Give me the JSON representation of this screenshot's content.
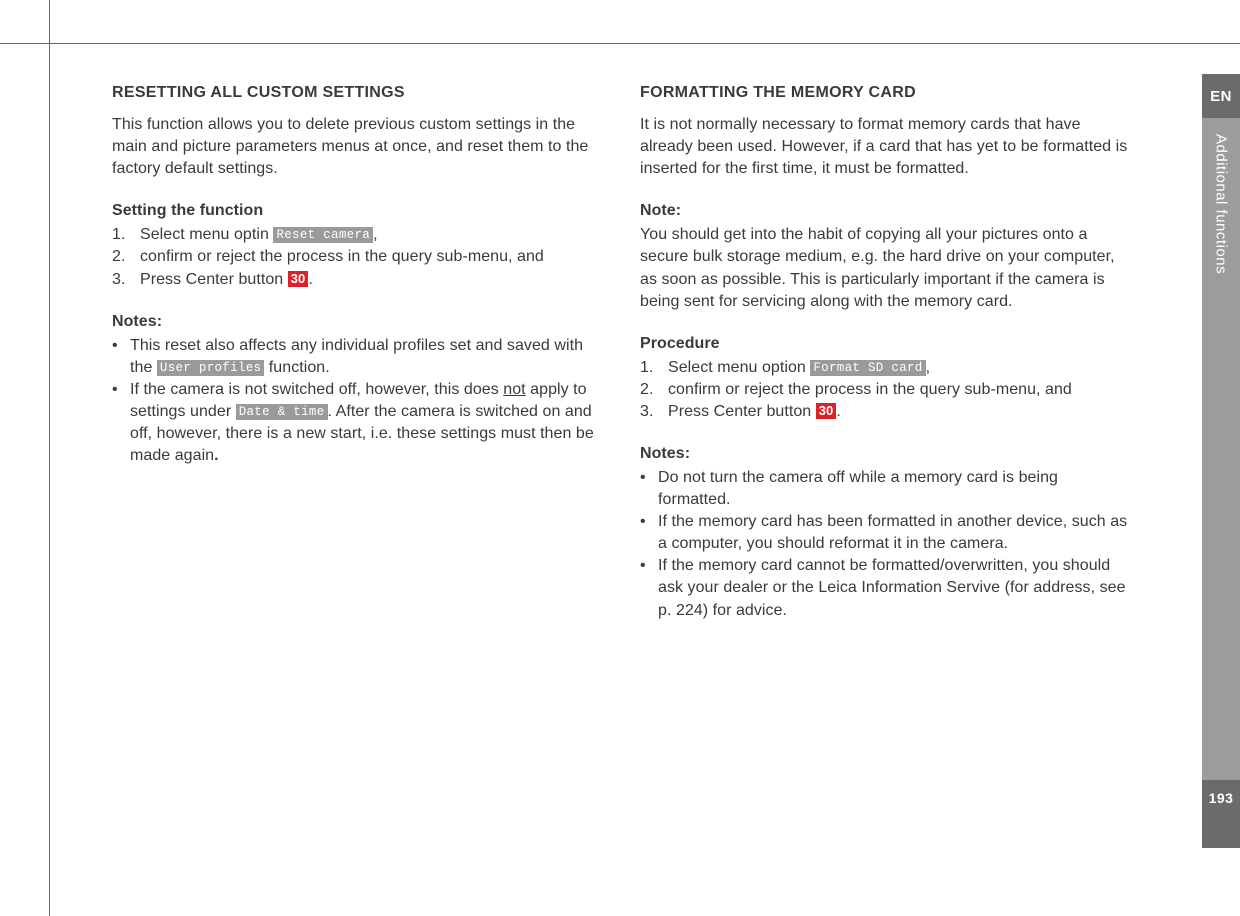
{
  "sidebar": {
    "lang": "EN",
    "section": "Additional functions",
    "page": "193"
  },
  "left": {
    "title": "RESETTING ALL CUSTOM SETTINGS",
    "intro": "This function allows you to delete previous custom settings in the main and picture parameters menus at once, and reset them to the factory default settings.",
    "setting_heading": "Setting the function",
    "steps": {
      "n1": "1.",
      "s1a": "Select menu optin ",
      "s1_menu": "Reset camera",
      "s1b": ",",
      "n2": "2.",
      "s2": "confirm or reject the process in the query sub-menu, and",
      "n3": "3.",
      "s3a": "Press Center button ",
      "s3_ref": "30",
      "s3b": "."
    },
    "notes_heading": "Notes:",
    "note1a": "This reset also affects any individual profiles set and saved with the ",
    "note1_menu": "User profiles",
    "note1b": " function.",
    "note2a": "If the camera is not switched off, however, this does ",
    "note2_not": "not",
    "note2b": " apply to settings under ",
    "note2_menu": "Date & time",
    "note2c": ". After the camera is switched on and off, however, there is a new start, i.e. these settings must then be made again",
    "note2_dot": "."
  },
  "right": {
    "title": "FORMATTING THE MEMORY CARD",
    "intro": "It is not normally necessary to format memory cards that have already been used. However, if a card that has yet to be formatted is inserted for the first time, it must be formatted.",
    "note_heading": "Note:",
    "note_body": "You should get into the habit of copying all your pictures onto a secure bulk storage medium, e.g. the hard drive on your computer, as soon as possible. This is particularly important if the camera is being sent for servicing along with the memory card.",
    "procedure_heading": "Procedure",
    "steps": {
      "n1": "1.",
      "s1a": "Select menu option ",
      "s1_menu": "Format SD card",
      "s1b": ",",
      "n2": "2.",
      "s2": "confirm or reject the process in the query sub-menu, and",
      "n3": "3.",
      "s3a": "Press Center button ",
      "s3_ref": "30",
      "s3b": "."
    },
    "notes_heading": "Notes:",
    "note1": "Do not turn the camera off while a memory card is being formatted.",
    "note2": "If the memory card has been formatted in another device, such as a computer, you should reformat it in the camera.",
    "note3": "If the memory card cannot be formatted/overwritten, you should ask your dealer or the Leica Information Servive (for address, see p. 224) for advice."
  },
  "bullet": "•"
}
